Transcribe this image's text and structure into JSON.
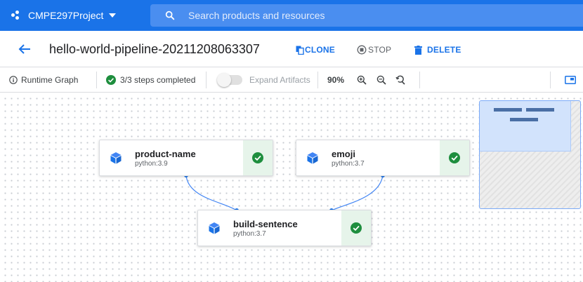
{
  "topbar": {
    "project_name": "CMPE297Project",
    "search_placeholder": "Search products and resources"
  },
  "header": {
    "title": "hello-world-pipeline-20211208063307",
    "actions": {
      "clone": "CLONE",
      "stop": "STOP",
      "delete": "DELETE"
    }
  },
  "toolbar": {
    "runtime_graph": "Runtime Graph",
    "steps_status": "3/3 steps completed",
    "expand_artifacts": "Expand Artifacts",
    "zoom_level": "90%"
  },
  "graph": {
    "nodes": [
      {
        "name": "product-name",
        "image": "python:3.9",
        "status": "succeeded"
      },
      {
        "name": "emoji",
        "image": "python:3.7",
        "status": "succeeded"
      },
      {
        "name": "build-sentence",
        "image": "python:3.7",
        "status": "succeeded"
      }
    ]
  },
  "colors": {
    "brand_blue": "#1a73e8",
    "success_green": "#1e8e3e",
    "success_bg": "#e6f4ea",
    "node_icon_blue": "#1a73e8"
  }
}
